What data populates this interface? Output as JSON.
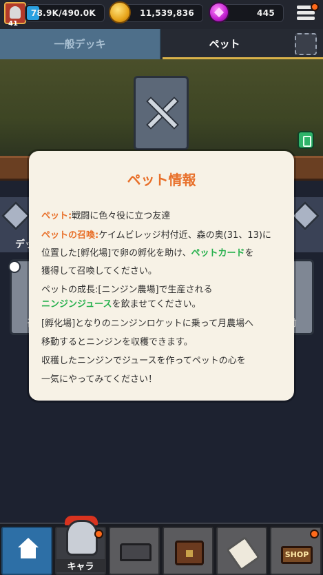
{
  "header": {
    "level": "41",
    "xp_text": "78.9K/490.0K",
    "xp_fraction": 0.161,
    "coins": "11,539,836",
    "gems": "445"
  },
  "tabs": [
    {
      "label": "一般デッキ",
      "active": false
    },
    {
      "label": "ペット",
      "active": true
    }
  ],
  "background": {
    "deck_text": "デッ",
    "left_card_label": "召",
    "right_card_label": "前"
  },
  "modal": {
    "title": "ペット情報",
    "line1_label": "ペット:",
    "line1_text": "戦闘に色々役に立つ友達",
    "line2_label": "ペットの召喚:",
    "line2_text": "ケイムビレッジ村付近、森の奥(31、13)に",
    "line3_pre": "位置した[孵化場]で卵の孵化を助け、",
    "line3_link": "ペットカード",
    "line3_post": "を",
    "line4": "獲得して召喚してください。",
    "line5": "ペットの成長:[ニンジン農場]で生産される",
    "line6_link": "ニンジンジュース",
    "line6_post": "を飲ませてください。",
    "line7": "[孵化場]となりのニンジンロケットに乗って月農場へ",
    "line8": "移動するとニンジンを収穫できます。",
    "line9": "収穫したニンジンでジュースを作ってペットの心を",
    "line10": "一気にやってみてください！"
  },
  "bottom_nav": {
    "chara_label": "キャラ",
    "shop_label": "SHOP"
  },
  "colors": {
    "accent_orange": "#e8702a",
    "link_green": "#25b04c",
    "notification": "#ff6a1a"
  }
}
